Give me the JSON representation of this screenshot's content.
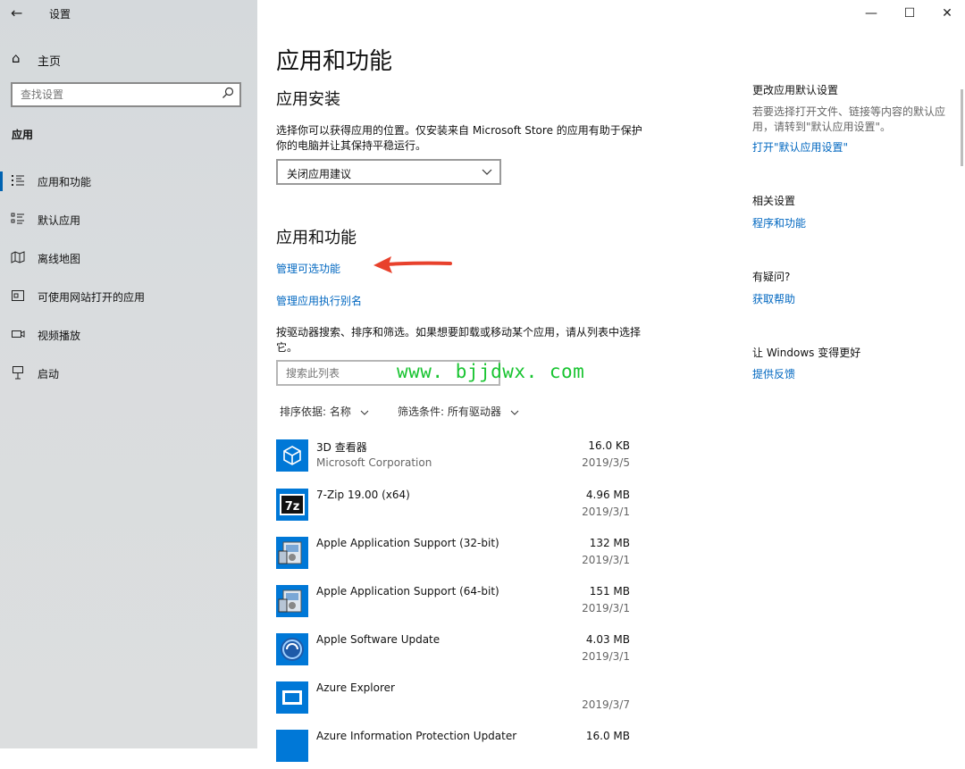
{
  "window": {
    "title": "设置",
    "back_icon": "←",
    "minimize": "—",
    "maximize": "☐",
    "close": "✕"
  },
  "nav": {
    "home_label": "主页",
    "search_placeholder": "查找设置",
    "section_label": "应用",
    "items": [
      {
        "label": "应用和功能",
        "icon": "apps-features-icon",
        "active": true
      },
      {
        "label": "默认应用",
        "icon": "default-apps-icon",
        "active": false
      },
      {
        "label": "离线地图",
        "icon": "offline-maps-icon",
        "active": false
      },
      {
        "label": "可使用网站打开的应用",
        "icon": "apps-for-websites-icon",
        "active": false
      },
      {
        "label": "视频播放",
        "icon": "video-playback-icon",
        "active": false
      },
      {
        "label": "启动",
        "icon": "startup-icon",
        "active": false
      }
    ]
  },
  "main": {
    "page_title": "应用和功能",
    "install_heading": "应用安装",
    "install_desc": "选择你可以获得应用的位置。仅安装来自 Microsoft Store 的应用有助于保护你的电脑并让其保持平稳运行。",
    "install_dropdown_value": "关闭应用建议",
    "apps_heading": "应用和功能",
    "link_optional_features": "管理可选功能",
    "link_aliases": "管理应用执行别名",
    "search_desc": "按驱动器搜索、排序和筛选。如果想要卸载或移动某个应用，请从列表中选择它。",
    "search_list_placeholder": "搜索此列表",
    "watermark": "www. bjjdwx. com",
    "sort_label": "排序依据: 名称",
    "filter_label": "筛选条件: 所有驱动器",
    "apps": [
      {
        "name": "3D 查看器",
        "publisher": "Microsoft Corporation",
        "size": "16.0 KB",
        "date": "2019/3/5",
        "icon": "3d-viewer-icon"
      },
      {
        "name": "7-Zip 19.00 (x64)",
        "publisher": "",
        "size": "4.96 MB",
        "date": "2019/3/1",
        "icon": "7zip-icon"
      },
      {
        "name": "Apple Application Support (32-bit)",
        "publisher": "",
        "size": "132 MB",
        "date": "2019/3/1",
        "icon": "installer-icon"
      },
      {
        "name": "Apple Application Support (64-bit)",
        "publisher": "",
        "size": "151 MB",
        "date": "2019/3/1",
        "icon": "installer-icon"
      },
      {
        "name": "Apple Software Update",
        "publisher": "",
        "size": "4.03 MB",
        "date": "2019/3/1",
        "icon": "apple-update-icon"
      },
      {
        "name": "Azure Explorer",
        "publisher": "",
        "size": "",
        "date": "2019/3/7",
        "icon": "azure-explorer-icon"
      },
      {
        "name": "Azure Information Protection Updater",
        "publisher": "",
        "size": "16.0 MB",
        "date": "",
        "icon": "azure-ip-icon"
      }
    ]
  },
  "side": {
    "default_heading": "更改应用默认设置",
    "default_text": "若要选择打开文件、链接等内容的默认应用，请转到\"默认应用设置\"。",
    "default_link": "打开\"默认应用设置\"",
    "related_heading": "相关设置",
    "related_link": "程序和功能",
    "question_heading": "有疑问?",
    "question_link": "获取帮助",
    "better_heading": "让 Windows 变得更好",
    "better_link": "提供反馈"
  },
  "colors": {
    "accent": "#0063b1",
    "link": "#0067c0",
    "app_tile": "#0078d7",
    "watermark": "#19c431",
    "arrow": "#e8412c"
  }
}
